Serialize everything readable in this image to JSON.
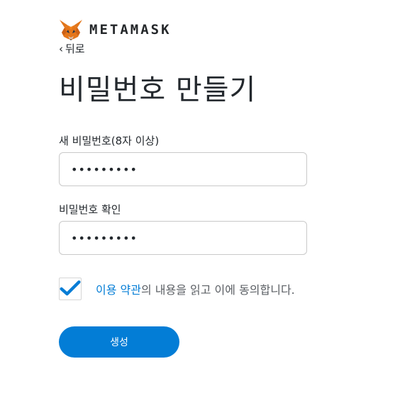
{
  "header": {
    "logo_icon": "metamask-fox-icon",
    "wordmark": "METAMASK"
  },
  "back": {
    "chevron": "‹",
    "label": "뒤로"
  },
  "title": "비밀번호 만들기",
  "form": {
    "password": {
      "label": "새 비밀번호(8자 이상)",
      "value": "•••••••••"
    },
    "confirm": {
      "label": "비밀번호 확인",
      "value": "•••••••••"
    },
    "terms": {
      "checked": true,
      "link_text": "이용 약관",
      "rest_text": "의 내용을 읽고 이에 동의합니다."
    },
    "submit_label": "생성"
  },
  "colors": {
    "accent": "#037dd6",
    "checkmark": "#037dd6",
    "fox_orange": "#e2761b"
  }
}
